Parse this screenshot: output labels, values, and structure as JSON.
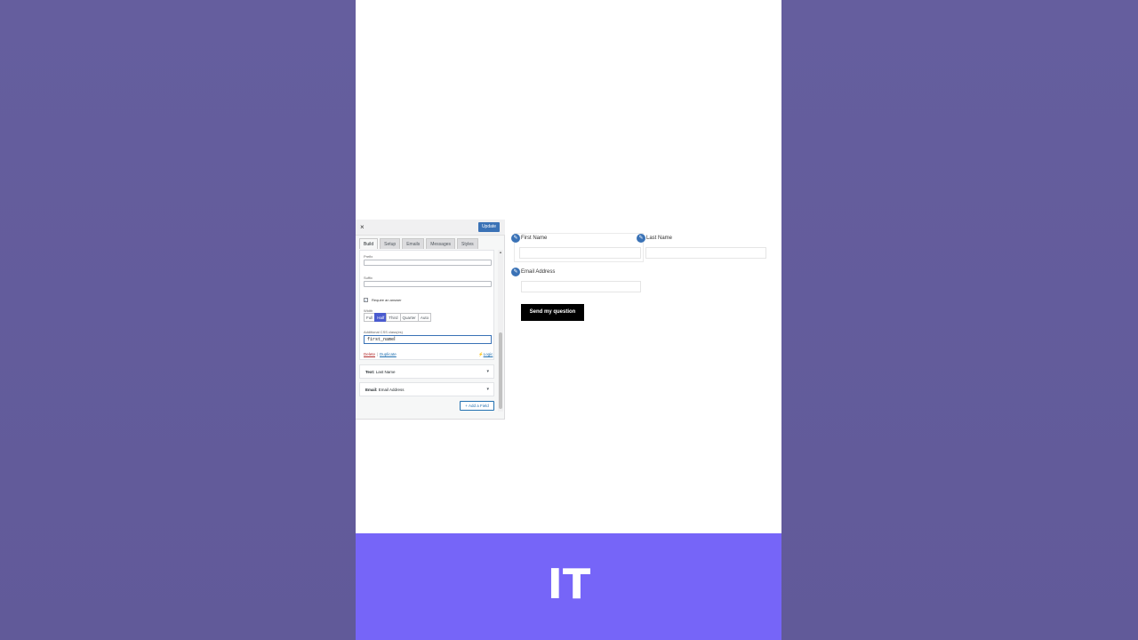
{
  "builder": {
    "close_icon": "×",
    "update_label": "Update",
    "tabs": [
      {
        "label": "Build",
        "active": true
      },
      {
        "label": "Setup",
        "active": false
      },
      {
        "label": "Emails",
        "active": false
      },
      {
        "label": "Messages",
        "active": false
      },
      {
        "label": "Styles",
        "active": false
      }
    ],
    "field": {
      "prefix_label": "Prefix",
      "suffix_label": "Suffix",
      "require_label": "Require an answer",
      "width_label": "Width",
      "width_options": [
        "Full",
        "Half",
        "Third",
        "Quarter",
        "Auto"
      ],
      "width_selected": "Half",
      "css_label": "Additional CSS class(es)",
      "css_value": "first_name",
      "delete_label": "Delete",
      "duplicate_label": "Duplicate",
      "logic_label": "Logic"
    },
    "collapsed_fields": [
      {
        "type": "Text:",
        "name": "Last Name"
      },
      {
        "type": "Email:",
        "name": "Email Address"
      }
    ],
    "add_field_label": "Add a Field"
  },
  "preview": {
    "first_name_label": "First Name",
    "last_name_label": "Last Name",
    "email_label": "Email Address",
    "submit_label": "Send my question"
  },
  "caption": {
    "text": "IT"
  },
  "colors": {
    "background": "#625b9b",
    "caption_bar": "#7665f8",
    "accent": "#3a72b6",
    "width_active": "#4a5bcf"
  }
}
